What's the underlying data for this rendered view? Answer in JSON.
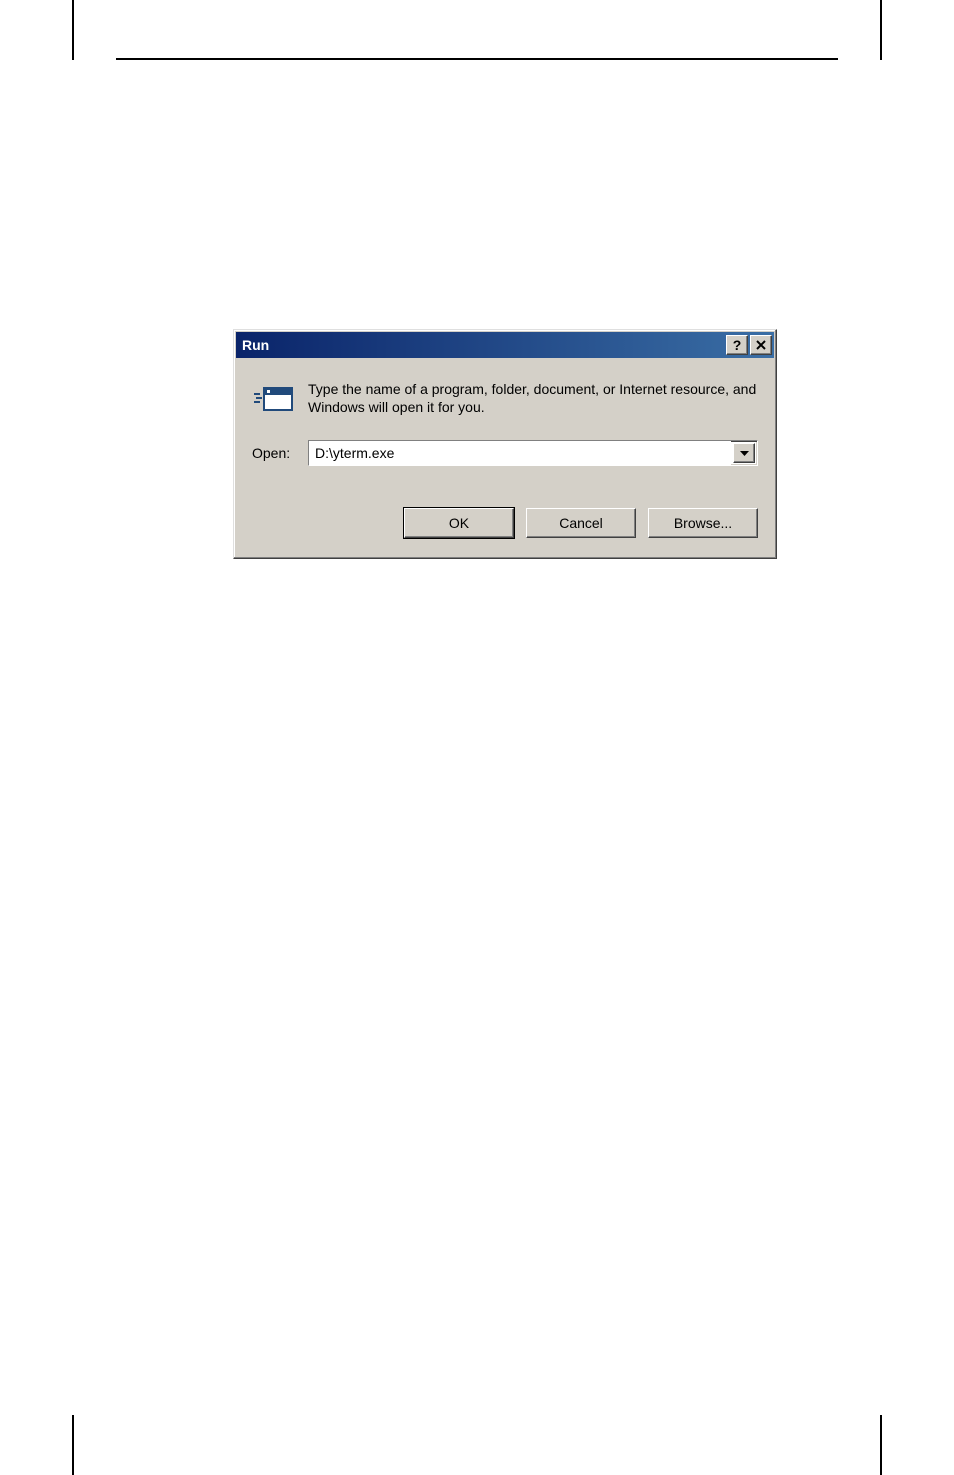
{
  "dialog": {
    "title": "Run",
    "description": "Type the name of a program, folder, document, or Internet resource, and Windows will open it for you.",
    "open_label": "Open:",
    "open_value": "D:\\yterm.exe",
    "buttons": {
      "ok": "OK",
      "cancel": "Cancel",
      "browse": "Browse..."
    }
  }
}
